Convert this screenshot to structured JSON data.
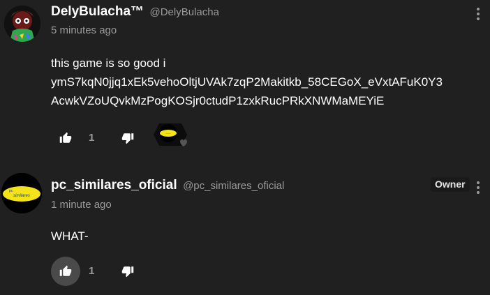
{
  "comments": [
    {
      "author": "DelyBulacha™",
      "handle": "@DelyBulacha",
      "timestamp": "5 minutes ago",
      "body_line1": "this game is so good i",
      "body_line2": "ymS7kqN0jjq1xEk5vehoOltjUVAk7zqP2Makitkb_58CEGoX_eVxtAFuK0Y3",
      "body_line3": "AcwkVZoUQvkMzPogKOSjr0ctudP1zxkRucPRkXNWMaMEYiE",
      "likes": "1",
      "avatar_icon": "cartoon-character-avatar",
      "reaction_icon": "creator-heart-reaction"
    },
    {
      "author": "pc_similares_oficial",
      "handle": "@pc_similares_oficial",
      "timestamp": "1 minute ago",
      "body": "WHAT-",
      "badge": "Owner",
      "likes": "1",
      "avatar_icon": "yellow-logo-avatar"
    }
  ],
  "colors": {
    "background": "#202020",
    "text_primary": "#ffffff",
    "text_secondary": "#9a9a9a",
    "active_button": "#4a4a4a"
  }
}
